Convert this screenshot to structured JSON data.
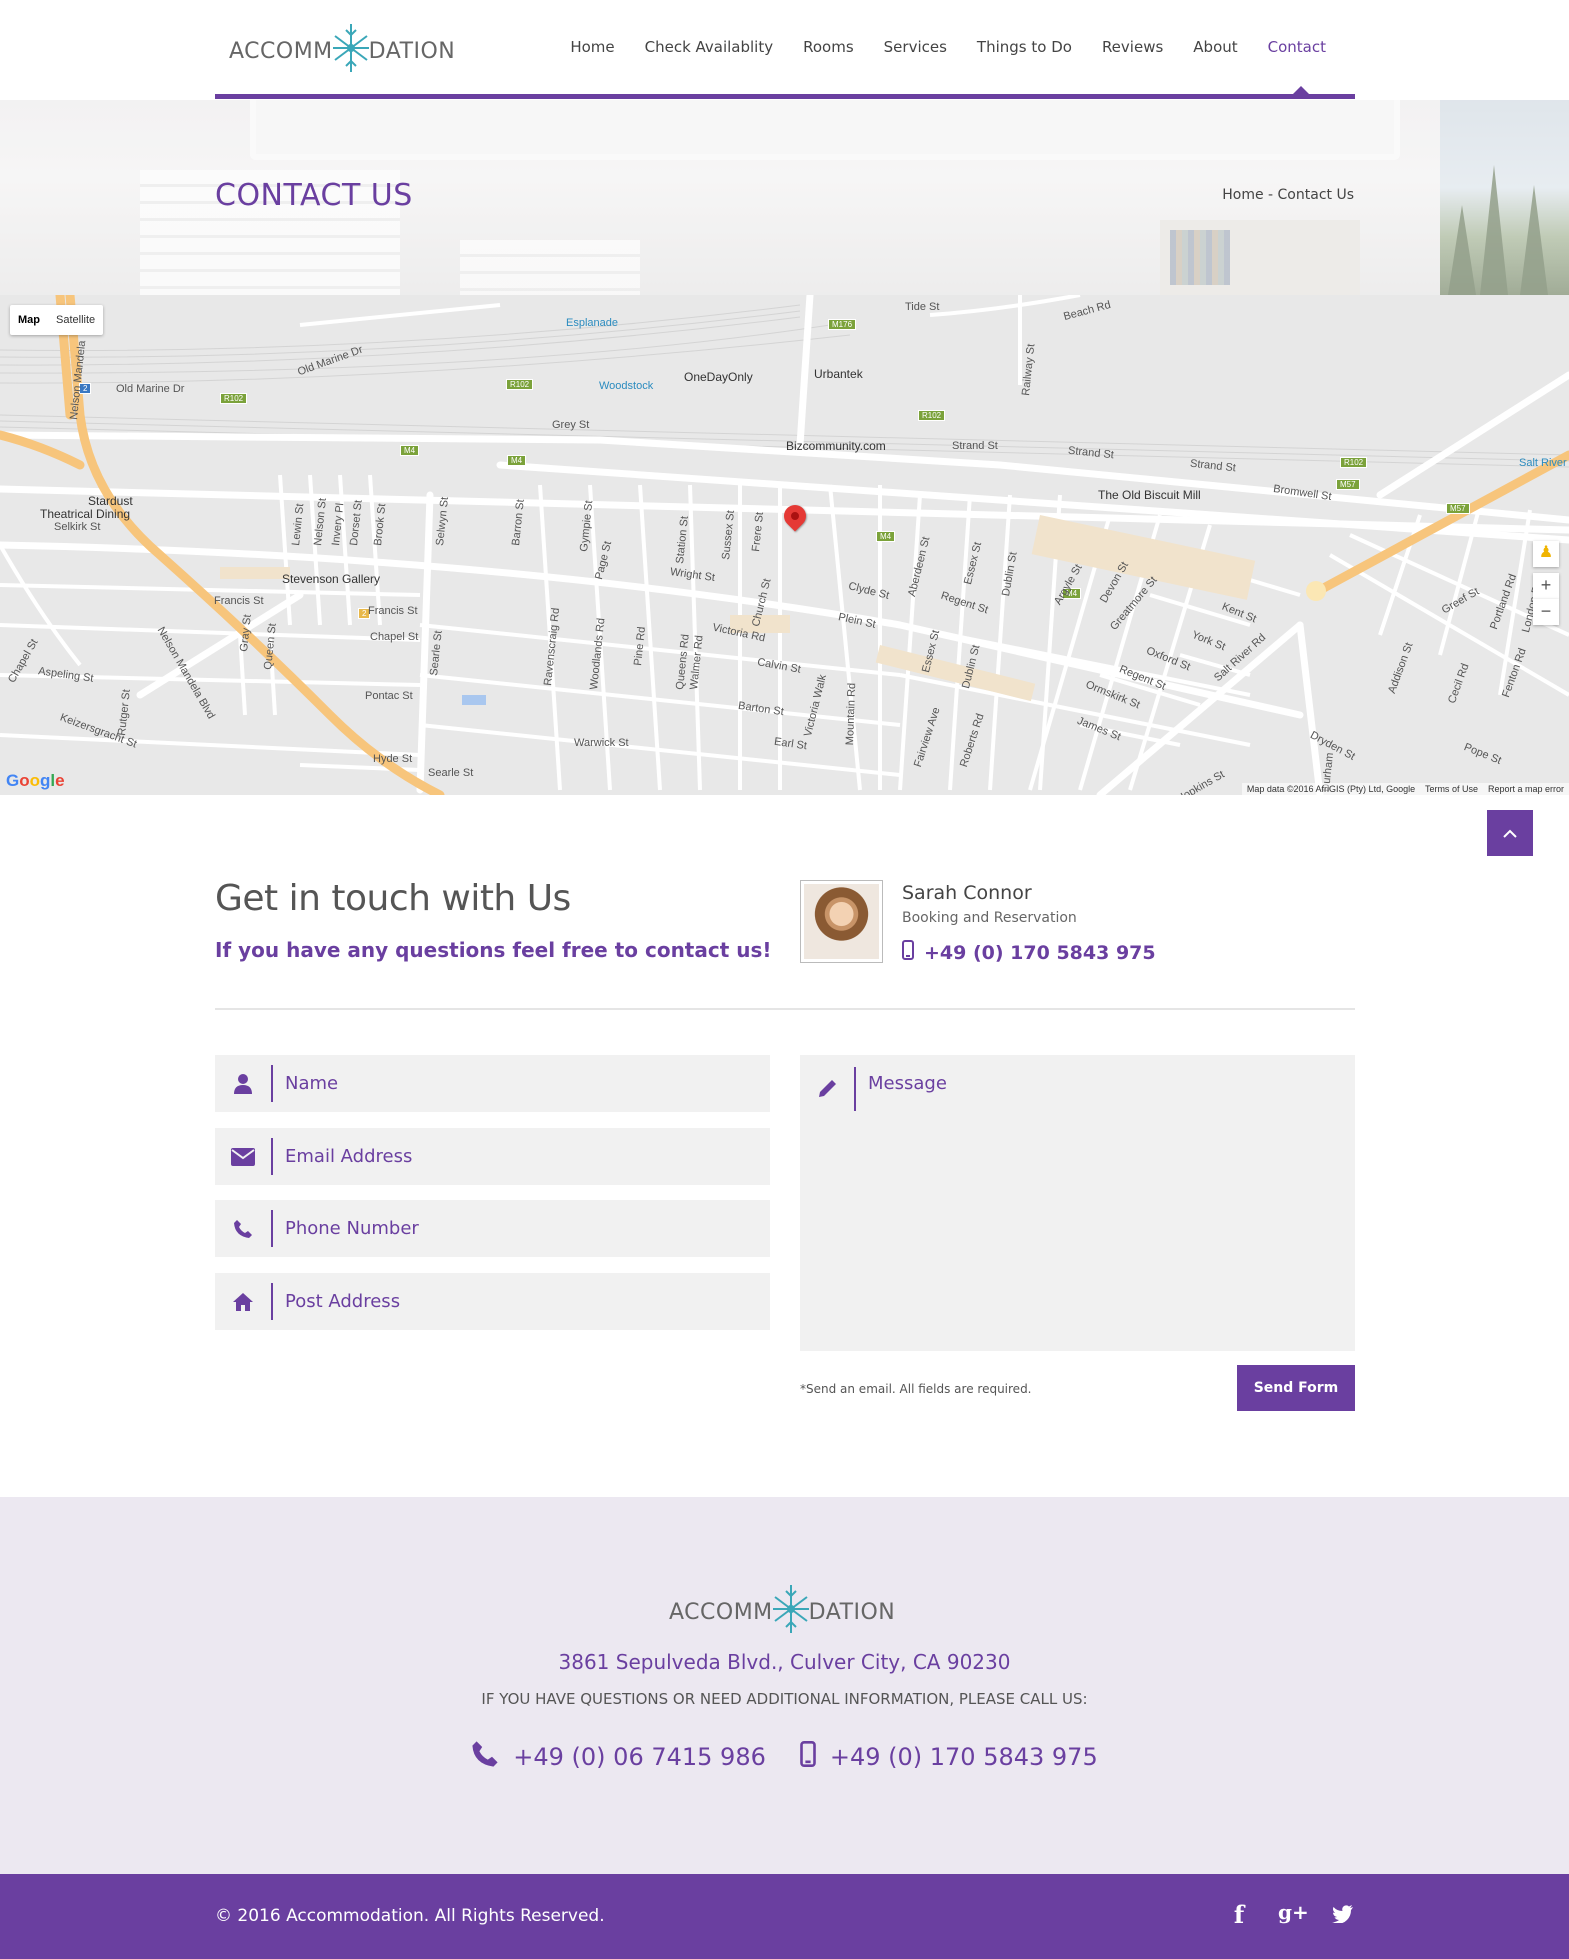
{
  "brand": {
    "logo_left": "ACCOMM",
    "logo_right": "DATION",
    "colors": {
      "accent": "#6a3fa0",
      "logo_snowflake": "#3aa7b8"
    }
  },
  "nav": {
    "items": [
      "Home",
      "Check Availablity",
      "Rooms",
      "Services",
      "Things to Do",
      "Reviews",
      "About",
      "Contact"
    ],
    "active": "Contact"
  },
  "banner": {
    "title": "CONTACT US",
    "breadcrumb": "Home - Contact Us"
  },
  "map": {
    "toggle": [
      "Map",
      "Satellite"
    ],
    "selected": "Map",
    "zoom_in": "+",
    "zoom_out": "−",
    "logo": "Google",
    "credit": "Map data ©2016 AfriGIS (Pty) Ltd, Google",
    "terms": "Terms of Use",
    "report": "Report a map error",
    "labels": {
      "esplanade": "Esplanade",
      "woodstock": "Woodstock",
      "onedayonly": "OneDayOnly",
      "urbantek": "Urbantek",
      "bizcommunity": "Bizcommunity.com",
      "greyst": "Grey St",
      "strandst": "Strand St",
      "strandst2": "Strand St",
      "strandst3": "Strand St",
      "oldbiscuit": "The Old Biscuit Mill",
      "bromwell": "Bromwell St",
      "saltriver": "Salt River",
      "stardust": "Stardust",
      "theatrical": "Theatrical Dining",
      "selkirk": "Selkirk St",
      "stevenson": "Stevenson Gallery",
      "francis": "Francis St",
      "francis2": "Francis St",
      "chapel": "Chapel St",
      "chapel2": "Chapel St",
      "aspeling": "Aspeling St",
      "pontac": "Pontac St",
      "hyde": "Hyde St",
      "searle": "Searle St",
      "warwick": "Warwick St",
      "barton": "Barton St",
      "earl": "Earl St",
      "calvin": "Calvin St",
      "victoria": "Victoria Rd",
      "wright": "Wright St",
      "plein": "Plein St",
      "clyde": "Clyde St",
      "regent": "Regent St",
      "regent2": "Regent St",
      "kent": "Kent St",
      "york": "York St",
      "oxford": "Oxford St",
      "ormskirk": "Ormskirk St",
      "james": "James St",
      "hopkins": "Hopkins St",
      "dryden": "Dryden St",
      "pope": "Pope St",
      "oldmarine": "Old Marine Dr",
      "oldmarine2": "Old Marine Dr",
      "tide": "Tide St",
      "beach": "Beach Rd",
      "keizers": "Keizersgracht St",
      "nelson": "Nelson Mandela Blvd",
      "nelson2": "Nelson Mandela",
      "railway": "Railway St",
      "saltriverrd": "Salt River Rd",
      "barron": "Barron St",
      "gympie": "Gympie St",
      "ravenscraig": "Ravenscraig Rd",
      "woodlands": "Woodlands Rd",
      "pine": "Pine Rd",
      "page": "Page St",
      "station": "Station St",
      "sussex": "Sussex St",
      "church": "Church St",
      "frere": "Frere St",
      "mountain": "Mountain Rd",
      "aberdeen": "Aberdeen St",
      "essex": "Essex St",
      "essex2": "Essex St",
      "dublin": "Dublin St",
      "dublin2": "Dublin St",
      "argyle": "Argyle St",
      "devon": "Devon St",
      "greatmore": "Greatmore St",
      "fairview": "Fairview Ave",
      "roberts": "Roberts Rd",
      "victoriawalk": "Victoria Walk",
      "queensrd": "Queens Rd",
      "walmer": "Walmer Rd",
      "addison": "Addison St",
      "cecil": "Cecil Rd",
      "fenton": "Fenton Rd",
      "portland": "Portland Rd",
      "london": "London Rd",
      "greef": "Greef St",
      "durham": "Durham",
      "lewin": "Lewin St",
      "nelsonst": "Nelson St",
      "invery": "Invery Pl",
      "dorset": "Dorset St",
      "brook": "Brook St",
      "selwyn": "Selwyn St",
      "searle2": "Searle St",
      "gray": "Gray St",
      "queen": "Queen St",
      "rutger": "Rutger St"
    },
    "shields": {
      "r102": "R102",
      "m4": "M4",
      "m176": "M176",
      "m57": "M57",
      "two": "2"
    }
  },
  "contact": {
    "title": "Get in touch with Us",
    "subtitle": "If you have any questions feel free to contact us!",
    "agent": {
      "name": "Sarah Connor",
      "role": "Booking and Reservation",
      "phone": "+49 (0) 170 5843 975"
    }
  },
  "form": {
    "name_placeholder": "Name",
    "email_placeholder": "Email Address",
    "phone_placeholder": "Phone Number",
    "address_placeholder": "Post Address",
    "message_placeholder": "Message",
    "note": "*Send an email. All fields are required.",
    "submit": "Send Form"
  },
  "footer": {
    "address": "3861 Sepulveda Blvd., Culver City, CA 90230",
    "info": "IF YOU HAVE QUESTIONS OR NEED ADDITIONAL INFORMATION, PLEASE CALL US:",
    "phone1": "+49 (0) 06 7415 986",
    "phone2": "+49 (0) 170 5843 975",
    "copyright": "© 2016 Accommodation. All Rights Reserved.",
    "social": [
      "facebook-icon",
      "google-plus-icon",
      "twitter-icon"
    ]
  }
}
